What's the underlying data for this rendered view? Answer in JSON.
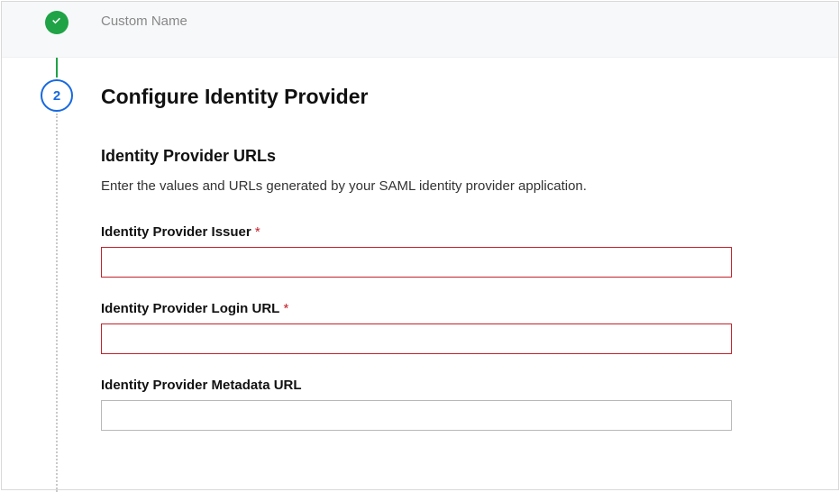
{
  "step1": {
    "label": "Custom Name"
  },
  "step2": {
    "number": "2",
    "title": "Configure Identity Provider",
    "section_title": "Identity Provider URLs",
    "section_desc": "Enter the values and URLs generated by your SAML identity provider application.",
    "fields": {
      "issuer": {
        "label": "Identity Provider Issuer",
        "required_mark": " *",
        "value": ""
      },
      "login_url": {
        "label": "Identity Provider Login URL",
        "required_mark": " *",
        "value": ""
      },
      "metadata_url": {
        "label": "Identity Provider Metadata URL",
        "value": ""
      }
    }
  }
}
